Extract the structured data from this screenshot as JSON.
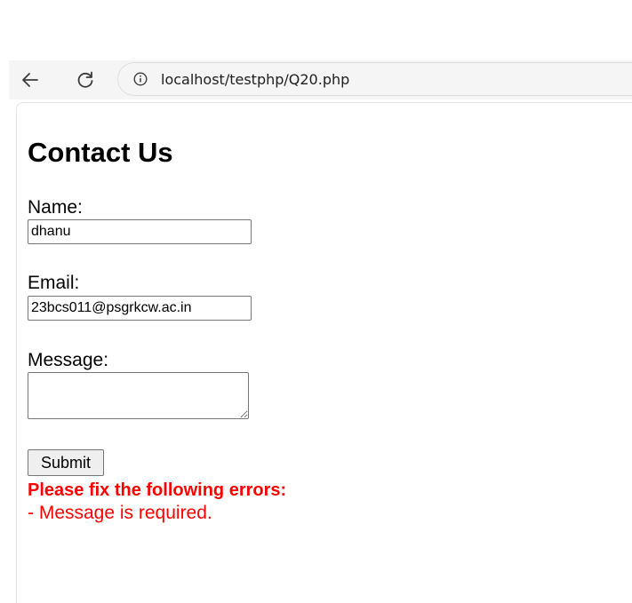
{
  "browser": {
    "url": "localhost/testphp/Q20.php",
    "icons": {
      "back": "arrow-left-icon",
      "reload": "reload-icon",
      "site_info": "info-icon"
    }
  },
  "page": {
    "title": "Contact Us",
    "form": {
      "name_label": "Name:",
      "name_value": "dhanu",
      "email_label": "Email:",
      "email_value": "23bcs011@psgrkcw.ac.in",
      "message_label": "Message:",
      "message_value": "",
      "submit_label": "Submit"
    },
    "errors": {
      "heading": "Please fix the following errors:",
      "items": [
        "- Message is required."
      ]
    }
  },
  "colors": {
    "error": "#ff0000",
    "toolbar_bg": "#f5f5f5"
  }
}
